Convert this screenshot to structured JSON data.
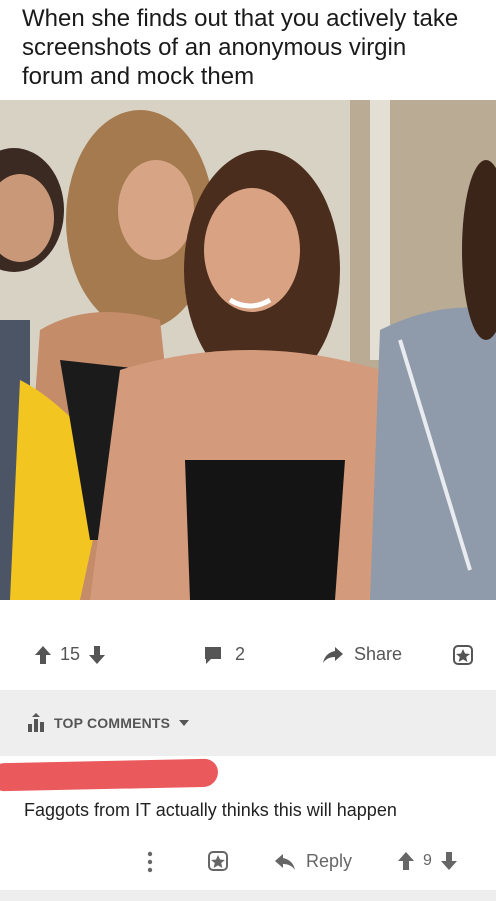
{
  "meme": {
    "caption": "When she finds out that you actively take screenshots of an anonymous virgin forum and mock them"
  },
  "post_actions": {
    "vote_count": "15",
    "comment_count": "2",
    "share_label": "Share"
  },
  "comments_section": {
    "sort_label": "TOP COMMENTS"
  },
  "comment": {
    "body": "Faggots from IT actually thinks this will happen",
    "reply_label": "Reply",
    "vote_count": "9"
  },
  "colors": {
    "redaction": "#ea5a5d",
    "header_bg": "#eeeeef",
    "icon_gray": "#555555"
  }
}
